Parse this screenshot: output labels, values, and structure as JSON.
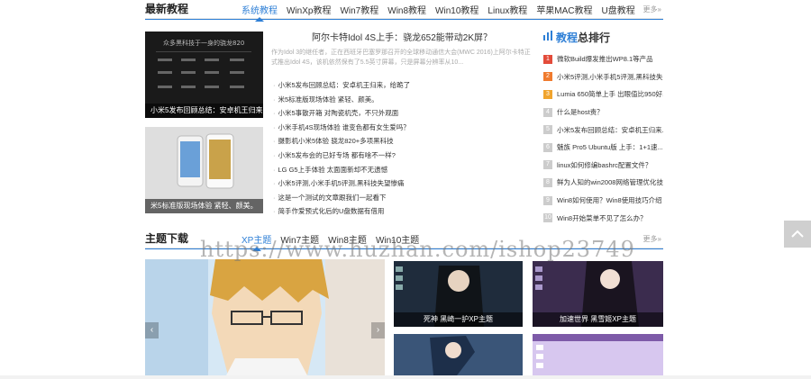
{
  "latest": {
    "title": "最新教程",
    "tabs": [
      "系统教程",
      "WinXp教程",
      "Win7教程",
      "Win8教程",
      "Win10教程",
      "Linux教程",
      "苹果MAC教程",
      "U盘教程"
    ],
    "more": "更多»",
    "thumb1_caption": "小米5发布回顾总结：安卓机王归来...",
    "thumb2_caption": "米5标准版现场体验 紧轻、颜美。",
    "thumb1_text": "众多黑科技于一身的骁龙820",
    "headline": "阿尔卡特Idol 4S上手：骁龙652能带动2K屏？",
    "summary": "作为Idol 3的继任者，正在西班牙巴塞罗那召开的全球移动通信大会(MWC 2016)上阿尔卡特正式推出Idol 4S，该机依然保有了5.5英寸屏幕，只是屏幕分辨率从10...",
    "news": [
      "小米5发布回顾总结：安卓机王归来，给跪了",
      "米5标准版现场体验 紧轻、颜美。",
      "小米5事散开箱 对陶瓷机壳，不只外观面",
      "小米手机4S现场体验 谁变色都有女生爱吗？",
      "摄影机小米5体验 骁龙820+多项黑科技",
      "小米5发布会的已好专场 都有啥不一样?",
      "LG G5上手体验 太面面新却不无遗憾",
      "小米5评测,小米手机5评测,黑科技失望惨痛",
      "这是一个测试的文章跟我们一起看下",
      "简手作爱预式化后的U盘数据有借用"
    ]
  },
  "ranking": {
    "title_blue": "教程",
    "title_rest": "总排行",
    "items": [
      "微软Build爆发推出WP8.1等产品",
      "小米5评测,小米手机5评测,黑科技失...",
      "Lumia 650简单上手 出眼值比950好...",
      "什么是host责？",
      "小米5发布回顾总结：安卓机王归来...",
      "魅族 Pro5 Ubuntu版 上手：1+1速...",
      "linux如何修编bashrc配置文件？",
      "鲜为人知的win2008网络管理优化技巧",
      "Win8如何使用？Win8使用技巧介绍",
      "Win8开始菜单不见了怎么办？"
    ]
  },
  "themes": {
    "title": "主题下载",
    "tabs": [
      "XP主题",
      "Win7主题",
      "Win8主题",
      "Win10主题"
    ],
    "more": "更多»",
    "cap1": "死神 黑崎一护XP主题",
    "cap2": "加速世界 黑雪姬XP主题"
  },
  "watermark": "https://www.huzhan.com/ishop23749"
}
